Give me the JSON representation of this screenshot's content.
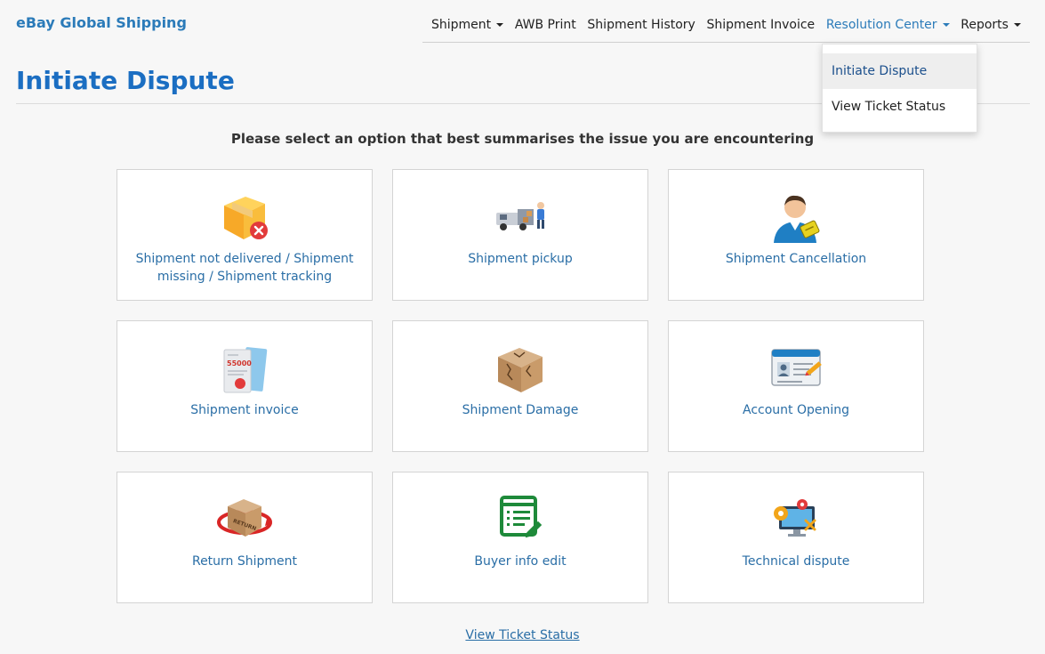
{
  "brand": "eBay Global Shipping",
  "nav": {
    "items": [
      {
        "label": "Shipment",
        "has_caret": true,
        "active": false
      },
      {
        "label": "AWB Print",
        "has_caret": false,
        "active": false
      },
      {
        "label": "Shipment History",
        "has_caret": false,
        "active": false
      },
      {
        "label": "Shipment Invoice",
        "has_caret": false,
        "active": false
      },
      {
        "label": "Resolution Center",
        "has_caret": true,
        "active": true
      },
      {
        "label": "Reports",
        "has_caret": true,
        "active": false
      }
    ]
  },
  "dropdown": {
    "items": [
      {
        "label": "Initiate Dispute",
        "highlighted": true
      },
      {
        "label": "View Ticket Status",
        "highlighted": false
      }
    ]
  },
  "page_title": "Initiate Dispute",
  "prompt": "Please select an option that best summarises the issue you are encountering",
  "options": [
    {
      "label": "Shipment not delivered / Shipment missing / Shipment tracking",
      "icon": "box-error-icon"
    },
    {
      "label": "Shipment pickup",
      "icon": "delivery-truck-icon"
    },
    {
      "label": "Shipment Cancellation",
      "icon": "person-ticket-icon"
    },
    {
      "label": "Shipment invoice",
      "icon": "invoice-icon"
    },
    {
      "label": "Shipment Damage",
      "icon": "damaged-box-icon"
    },
    {
      "label": "Account Opening",
      "icon": "id-card-icon"
    },
    {
      "label": "Return Shipment",
      "icon": "return-box-icon"
    },
    {
      "label": "Buyer info edit",
      "icon": "edit-document-icon"
    },
    {
      "label": "Technical dispute",
      "icon": "monitor-gear-icon"
    }
  ],
  "footer_link": "View Ticket Status",
  "colors": {
    "brand": "#2b7bb9",
    "title": "#1b6ec2",
    "link": "#2a6ea6",
    "background": "#f7f7f7"
  }
}
